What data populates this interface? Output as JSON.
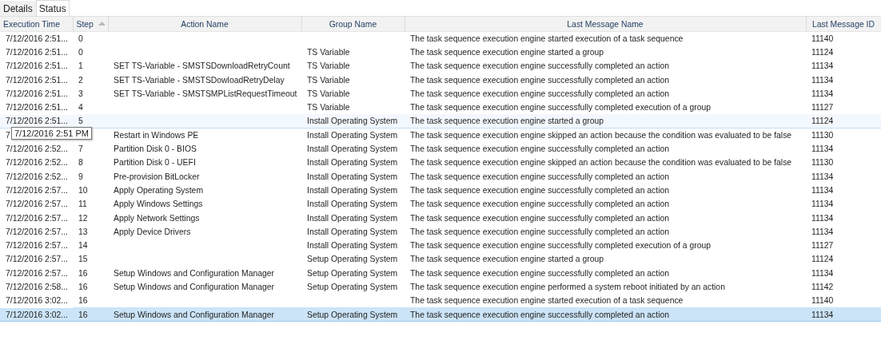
{
  "tabs": [
    {
      "label": "Details",
      "selected": false
    },
    {
      "label": "Status",
      "selected": true
    }
  ],
  "table": {
    "columns": [
      {
        "label": "Execution Time",
        "sorted": false
      },
      {
        "label": "Step",
        "sorted": true
      },
      {
        "label": "Action Name",
        "sorted": false
      },
      {
        "label": "Group Name",
        "sorted": false
      },
      {
        "label": "Last Message Name",
        "sorted": false
      },
      {
        "label": "Last Message ID",
        "sorted": false
      }
    ],
    "rows": [
      {
        "time": "7/12/2016 2:51...",
        "step": "0",
        "action": "",
        "group": "",
        "message": "The task sequence execution engine started execution of a task sequence",
        "id": "11140",
        "selected": false,
        "hovered": false
      },
      {
        "time": "7/12/2016 2:51...",
        "step": "0",
        "action": "",
        "group": "TS Variable",
        "message": "The task sequence execution engine started a group",
        "id": "11124",
        "selected": false,
        "hovered": false
      },
      {
        "time": "7/12/2016 2:51...",
        "step": "1",
        "action": "SET TS-Variable - SMSTSDownloadRetryCount",
        "group": "TS Variable",
        "message": "The task sequence execution engine successfully completed an action",
        "id": "11134",
        "selected": false,
        "hovered": false
      },
      {
        "time": "7/12/2016 2:51...",
        "step": "2",
        "action": "SET TS-Variable - SMSTSDowloadRetryDelay",
        "group": "TS Variable",
        "message": "The task sequence execution engine successfully completed an action",
        "id": "11134",
        "selected": false,
        "hovered": false
      },
      {
        "time": "7/12/2016 2:51...",
        "step": "3",
        "action": "SET TS-Variable - SMSTSMPListRequestTimeout",
        "group": "TS Variable",
        "message": "The task sequence execution engine successfully completed an action",
        "id": "11134",
        "selected": false,
        "hovered": false
      },
      {
        "time": "7/12/2016 2:51...",
        "step": "4",
        "action": "",
        "group": "TS Variable",
        "message": "The task sequence execution engine successfully completed execution of a group",
        "id": "11127",
        "selected": false,
        "hovered": false
      },
      {
        "time": "7/12/2016 2:51...",
        "step": "5",
        "action": "",
        "group": "Install Operating System",
        "message": "The task sequence execution engine started a group",
        "id": "11124",
        "selected": false,
        "hovered": true
      },
      {
        "time": "7",
        "action": "Restart in Windows PE",
        "group": "Install Operating System",
        "message": "The task sequence execution engine skipped an action because the condition was evaluated to be false",
        "id": "11130",
        "selected": false,
        "hovered": false,
        "tooltip": "7/12/2016 2:51 PM"
      },
      {
        "time": "7/12/2016 2:52...",
        "step": "7",
        "action": "Partition Disk 0 - BIOS",
        "group": "Install Operating System",
        "message": "The task sequence execution engine successfully completed an action",
        "id": "11134",
        "selected": false,
        "hovered": false
      },
      {
        "time": "7/12/2016 2:52...",
        "step": "8",
        "action": "Partition Disk 0 - UEFI",
        "group": "Install Operating System",
        "message": "The task sequence execution engine skipped an action because the condition was evaluated to be false",
        "id": "11130",
        "selected": false,
        "hovered": false
      },
      {
        "time": "7/12/2016 2:52...",
        "step": "9",
        "action": "Pre-provision BitLocker",
        "group": "Install Operating System",
        "message": "The task sequence execution engine successfully completed an action",
        "id": "11134",
        "selected": false,
        "hovered": false
      },
      {
        "time": "7/12/2016 2:57...",
        "step": "10",
        "action": "Apply Operating System",
        "group": "Install Operating System",
        "message": "The task sequence execution engine successfully completed an action",
        "id": "11134",
        "selected": false,
        "hovered": false
      },
      {
        "time": "7/12/2016 2:57...",
        "step": "11",
        "action": "Apply Windows Settings",
        "group": "Install Operating System",
        "message": "The task sequence execution engine successfully completed an action",
        "id": "11134",
        "selected": false,
        "hovered": false
      },
      {
        "time": "7/12/2016 2:57...",
        "step": "12",
        "action": "Apply Network Settings",
        "group": "Install Operating System",
        "message": "The task sequence execution engine successfully completed an action",
        "id": "11134",
        "selected": false,
        "hovered": false
      },
      {
        "time": "7/12/2016 2:57...",
        "step": "13",
        "action": "Apply Device Drivers",
        "group": "Install Operating System",
        "message": "The task sequence execution engine successfully completed an action",
        "id": "11134",
        "selected": false,
        "hovered": false
      },
      {
        "time": "7/12/2016 2:57...",
        "step": "14",
        "action": "",
        "group": "Install Operating System",
        "message": "The task sequence execution engine successfully completed execution of a group",
        "id": "11127",
        "selected": false,
        "hovered": false
      },
      {
        "time": "7/12/2016 2:57...",
        "step": "15",
        "action": "",
        "group": "Setup Operating System",
        "message": "The task sequence execution engine started a group",
        "id": "11124",
        "selected": false,
        "hovered": false
      },
      {
        "time": "7/12/2016 2:57...",
        "step": "16",
        "action": "Setup Windows and Configuration Manager",
        "group": "Setup Operating System",
        "message": "The task sequence execution engine successfully completed an action",
        "id": "11134",
        "selected": false,
        "hovered": false
      },
      {
        "time": "7/12/2016 2:58...",
        "step": "16",
        "action": "Setup Windows and Configuration Manager",
        "group": "Setup Operating System",
        "message": "The task sequence execution engine performed a system reboot initiated by an action",
        "id": "11142",
        "selected": false,
        "hovered": false
      },
      {
        "time": "7/12/2016 3:02...",
        "step": "16",
        "action": "",
        "group": "",
        "message": "The task sequence execution engine started execution of a task sequence",
        "id": "11140",
        "selected": false,
        "hovered": false
      },
      {
        "time": "7/12/2016 3:02...",
        "step": "16",
        "action": "Setup Windows and Configuration Manager",
        "group": "Setup Operating System",
        "message": "The task sequence execution engine successfully completed an action",
        "id": "11134",
        "selected": true,
        "hovered": false
      }
    ]
  }
}
